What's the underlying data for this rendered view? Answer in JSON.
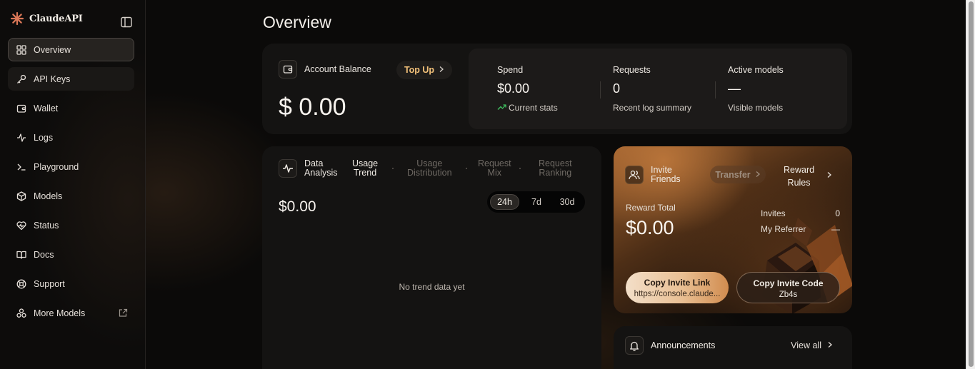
{
  "brand": {
    "name": "ClaudeAPI",
    "logo_color": "#d97757"
  },
  "sidebar": {
    "items": [
      {
        "label": "Overview",
        "icon": "grid-icon"
      },
      {
        "label": "API Keys",
        "icon": "key-icon"
      },
      {
        "label": "Wallet",
        "icon": "wallet-icon"
      },
      {
        "label": "Logs",
        "icon": "activity-icon"
      },
      {
        "label": "Playground",
        "icon": "terminal-icon"
      },
      {
        "label": "Models",
        "icon": "cube-icon"
      },
      {
        "label": "Status",
        "icon": "heart-pulse-icon"
      },
      {
        "label": "Docs",
        "icon": "book-icon"
      },
      {
        "label": "Support",
        "icon": "lifebuoy-icon"
      },
      {
        "label": "More Models",
        "icon": "apps-icon"
      }
    ],
    "active": "Overview"
  },
  "page": {
    "title": "Overview"
  },
  "balance": {
    "label": "Account Balance",
    "topup_label": "Top Up",
    "amount": "$ 0.00"
  },
  "stats": [
    {
      "title": "Spend",
      "value": "$0.00",
      "sub": "Current stats",
      "trend_color": "#3fbf5f"
    },
    {
      "title": "Requests",
      "value": "0",
      "sub": "Recent log summary"
    },
    {
      "title": "Active models",
      "value": "—",
      "sub": "Visible models"
    }
  ],
  "analysis": {
    "title_line1": "Data",
    "title_line2": "Analysis",
    "tabs": [
      {
        "l1": "Usage",
        "l2": "Trend"
      },
      {
        "l1": "Usage",
        "l2": "Distribution"
      },
      {
        "l1": "Request",
        "l2": "Mix"
      },
      {
        "l1": "Request",
        "l2": "Ranking"
      }
    ],
    "active_tab": 0,
    "amount": "$0.00",
    "ranges": [
      "24h",
      "7d",
      "30d"
    ],
    "active_range": "24h",
    "empty_text": "No trend data yet"
  },
  "invite": {
    "title_line1": "Invite",
    "title_line2": "Friends",
    "transfer_label": "Transfer",
    "rules_line1": "Reward",
    "rules_line2": "Rules",
    "reward_label": "Reward Total",
    "reward_amount": "$0.00",
    "invites_label": "Invites",
    "invites_value": "0",
    "referrer_label": "My Referrer",
    "referrer_value": "—",
    "copy_link_label": "Copy Invite Link",
    "copy_link_value": "https://console.claude...",
    "copy_code_label": "Copy Invite Code",
    "copy_code_value": "Zb4s"
  },
  "announcements": {
    "title": "Announcements",
    "view_all": "View all"
  }
}
